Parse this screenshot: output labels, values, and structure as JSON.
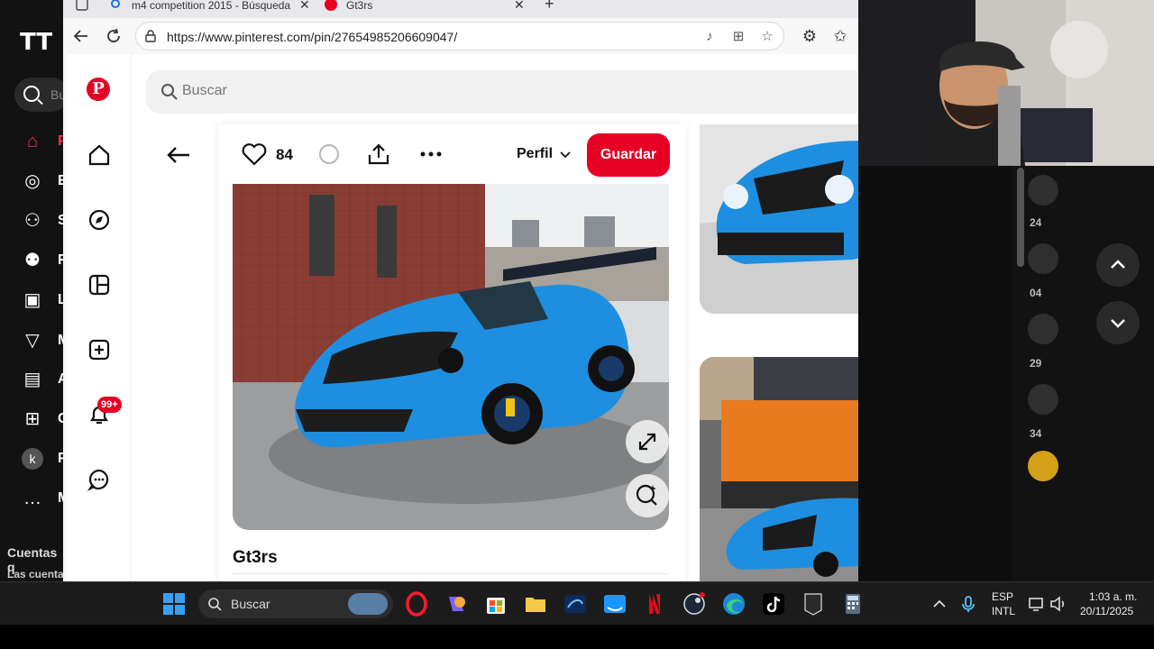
{
  "tiktok": {
    "logo": "TT",
    "search_placeholder": "Bu",
    "nav": [
      {
        "glyph": "⌂",
        "label": "Pa"
      },
      {
        "glyph": "◎",
        "label": "E"
      },
      {
        "glyph": "⚇",
        "label": "S"
      },
      {
        "glyph": "⚉",
        "label": "F"
      },
      {
        "glyph": "▣",
        "label": "L"
      },
      {
        "glyph": "▽",
        "label": "M"
      },
      {
        "glyph": "▤",
        "label": "A"
      },
      {
        "glyph": "⊞",
        "label": "C"
      },
      {
        "glyph": "k",
        "label": "P"
      },
      {
        "glyph": "…",
        "label": "M"
      }
    ],
    "footer_title": "Cuentas q",
    "footer_sub": "Las cuenta",
    "counts": [
      "24",
      "04",
      "29",
      "34"
    ]
  },
  "browser": {
    "tabs": [
      {
        "title": "m4 competition 2015 - Búsqueda"
      },
      {
        "title": "Gt3rs"
      }
    ],
    "url": "https://www.pinterest.com/pin/276549852066090​47/"
  },
  "pinterest": {
    "logo": "P",
    "search_placeholder": "Buscar",
    "badge": "99+",
    "likes": "84",
    "perfil": "Perfil",
    "save": "Guardar",
    "pin_title": "Gt3rs",
    "more": "..."
  },
  "taskbar": {
    "search": "Buscar",
    "lang1": "ESP",
    "lang2": "INTL",
    "time": "1:03 a. m.",
    "date": "20/11/2025"
  },
  "colors": {
    "pinterest_red": "#e60023",
    "car_blue": "#1e8fe0",
    "tiktok_red": "#fe2c55"
  }
}
